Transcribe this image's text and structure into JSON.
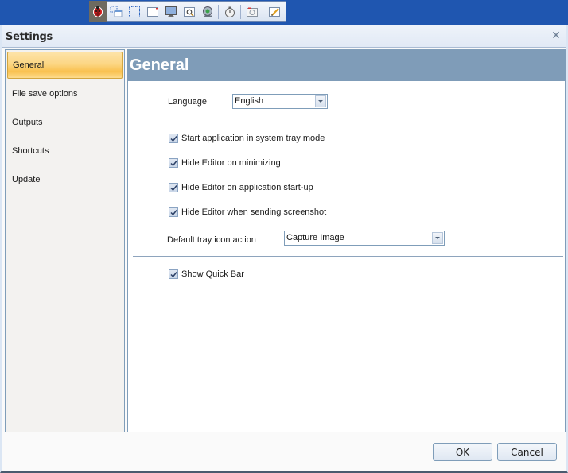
{
  "quickbar": {
    "tools": [
      {
        "icon": "ladybug-logo-icon",
        "label": "Logo"
      },
      {
        "icon": "capture-multiple-windows-icon"
      },
      {
        "icon": "capture-region-icon"
      },
      {
        "icon": "capture-window-icon"
      },
      {
        "icon": "capture-screen-icon"
      },
      {
        "icon": "capture-magnifier-icon"
      },
      {
        "icon": "webcam-icon"
      },
      {
        "icon": "timer-icon"
      },
      {
        "icon": "camera-icon"
      },
      {
        "icon": "editor-icon"
      }
    ]
  },
  "dialog": {
    "title": "Settings",
    "close_icon": "close-icon"
  },
  "sidebar": {
    "items": [
      {
        "label": "General",
        "active": true
      },
      {
        "label": "File save options",
        "active": false
      },
      {
        "label": "Outputs",
        "active": false
      },
      {
        "label": "Shortcuts",
        "active": false
      },
      {
        "label": "Update",
        "active": false
      }
    ]
  },
  "panel": {
    "title": "General",
    "language": {
      "label": "Language",
      "value": "English"
    },
    "options": [
      {
        "label": "Start application in system tray mode",
        "checked": true
      },
      {
        "label": "Hide Editor on minimizing",
        "checked": true
      },
      {
        "label": "Hide Editor on application start-up",
        "checked": true
      },
      {
        "label": "Hide Editor when sending screenshot",
        "checked": true
      }
    ],
    "tray_action": {
      "label": "Default tray icon action",
      "value": "Capture Image"
    },
    "quick_bar": {
      "label": "Show Quick Bar",
      "checked": true
    }
  },
  "buttons": {
    "ok": "OK",
    "cancel": "Cancel"
  },
  "colors": {
    "header_bg": "#7f9cb8",
    "active_item": "#fcd684",
    "border": "#7f9db9",
    "desktop": "#1f56b0"
  }
}
